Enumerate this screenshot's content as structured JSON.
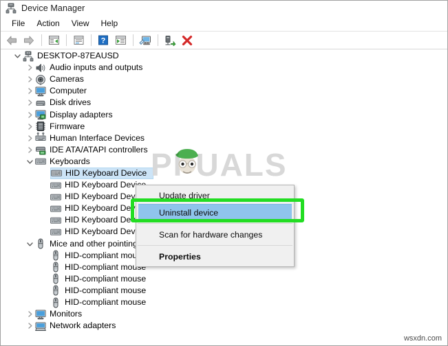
{
  "window": {
    "title": "Device Manager",
    "icon": "device-manager-icon"
  },
  "menubar": {
    "items": [
      {
        "label": "File"
      },
      {
        "label": "Action"
      },
      {
        "label": "View"
      },
      {
        "label": "Help"
      }
    ]
  },
  "toolbar": {
    "buttons": [
      {
        "name": "back-icon",
        "title": "Back"
      },
      {
        "name": "forward-icon",
        "title": "Forward"
      },
      {
        "name": "separator-1",
        "title": ""
      },
      {
        "name": "show-hidden-devices-icon",
        "title": "Show hidden devices"
      },
      {
        "name": "separator-2",
        "title": ""
      },
      {
        "name": "properties-icon",
        "title": "Properties"
      },
      {
        "name": "separator-3",
        "title": ""
      },
      {
        "name": "help-icon",
        "title": "Help"
      },
      {
        "name": "update-driver-icon",
        "title": "Update driver"
      },
      {
        "name": "separator-4",
        "title": ""
      },
      {
        "name": "scan-for-hardware-changes-icon",
        "title": "Scan for hardware changes"
      },
      {
        "name": "separator-5",
        "title": ""
      },
      {
        "name": "enable-device-icon",
        "title": "Enable device"
      },
      {
        "name": "uninstall-device-icon",
        "title": "Uninstall device"
      }
    ]
  },
  "tree": {
    "nodes": [
      {
        "label": "DESKTOP-87EAUSD",
        "indent": 0,
        "state": "expanded",
        "icon": "computer-root-icon",
        "selected": false
      },
      {
        "label": "Audio inputs and outputs",
        "indent": 1,
        "state": "collapsed",
        "icon": "speaker-icon",
        "selected": false
      },
      {
        "label": "Cameras",
        "indent": 1,
        "state": "collapsed",
        "icon": "camera-icon",
        "selected": false
      },
      {
        "label": "Computer",
        "indent": 1,
        "state": "collapsed",
        "icon": "monitor-icon",
        "selected": false
      },
      {
        "label": "Disk drives",
        "indent": 1,
        "state": "collapsed",
        "icon": "disk-drive-icon",
        "selected": false
      },
      {
        "label": "Display adapters",
        "indent": 1,
        "state": "collapsed",
        "icon": "display-adapter-icon",
        "selected": false
      },
      {
        "label": "Firmware",
        "indent": 1,
        "state": "collapsed",
        "icon": "firmware-chip-icon",
        "selected": false
      },
      {
        "label": "Human Interface Devices",
        "indent": 1,
        "state": "collapsed",
        "icon": "hid-icon",
        "selected": false
      },
      {
        "label": "IDE ATA/ATAPI controllers",
        "indent": 1,
        "state": "collapsed",
        "icon": "ide-controller-icon",
        "selected": false
      },
      {
        "label": "Keyboards",
        "indent": 1,
        "state": "expanded",
        "icon": "keyboard-icon",
        "selected": false
      },
      {
        "label": "HID Keyboard Device",
        "indent": 2,
        "state": "leaf",
        "icon": "keyboard-icon",
        "selected": true
      },
      {
        "label": "HID Keyboard Device",
        "indent": 2,
        "state": "leaf",
        "icon": "keyboard-icon",
        "selected": false
      },
      {
        "label": "HID Keyboard Device",
        "indent": 2,
        "state": "leaf",
        "icon": "keyboard-icon",
        "selected": false
      },
      {
        "label": "HID Keyboard Device",
        "indent": 2,
        "state": "leaf",
        "icon": "keyboard-icon",
        "selected": false
      },
      {
        "label": "HID Keyboard Device",
        "indent": 2,
        "state": "leaf",
        "icon": "keyboard-icon",
        "selected": false
      },
      {
        "label": "HID Keyboard Device",
        "indent": 2,
        "state": "leaf",
        "icon": "keyboard-icon",
        "selected": false
      },
      {
        "label": "Mice and other pointing devices",
        "indent": 1,
        "state": "expanded",
        "icon": "mouse-icon",
        "selected": false
      },
      {
        "label": "HID-compliant mouse",
        "indent": 2,
        "state": "leaf",
        "icon": "mouse-icon",
        "selected": false
      },
      {
        "label": "HID-compliant mouse",
        "indent": 2,
        "state": "leaf",
        "icon": "mouse-icon",
        "selected": false
      },
      {
        "label": "HID-compliant mouse",
        "indent": 2,
        "state": "leaf",
        "icon": "mouse-icon",
        "selected": false
      },
      {
        "label": "HID-compliant mouse",
        "indent": 2,
        "state": "leaf",
        "icon": "mouse-icon",
        "selected": false
      },
      {
        "label": "HID-compliant mouse",
        "indent": 2,
        "state": "leaf",
        "icon": "mouse-icon",
        "selected": false
      },
      {
        "label": "Monitors",
        "indent": 1,
        "state": "collapsed",
        "icon": "monitor-icon",
        "selected": false
      },
      {
        "label": "Network adapters",
        "indent": 1,
        "state": "collapsed",
        "icon": "network-adapter-icon",
        "selected": false
      }
    ]
  },
  "context_menu": {
    "items": [
      {
        "label": "Update driver",
        "type": "item",
        "highlighted": false,
        "bold": false
      },
      {
        "label": "Uninstall device",
        "type": "item",
        "highlighted": true,
        "bold": false
      },
      {
        "label": "",
        "type": "separator",
        "highlighted": false,
        "bold": false
      },
      {
        "label": "Scan for hardware changes",
        "type": "item",
        "highlighted": false,
        "bold": false
      },
      {
        "label": "",
        "type": "separator",
        "highlighted": false,
        "bold": false
      },
      {
        "label": "Properties",
        "type": "item",
        "highlighted": false,
        "bold": true
      }
    ]
  },
  "annotation": {
    "highlight_color": "#22dd22",
    "target_label": "Uninstall device"
  },
  "watermarks": {
    "center_text": "PPUALS",
    "center_full": "APPUALS",
    "corner_text": "wsxdn.com"
  },
  "colors": {
    "selection_blue": "#cce4f7",
    "menu_highlight_blue": "#8fc4ec",
    "menu_background": "#f0f0f0",
    "annotation_green": "#22dd22"
  }
}
